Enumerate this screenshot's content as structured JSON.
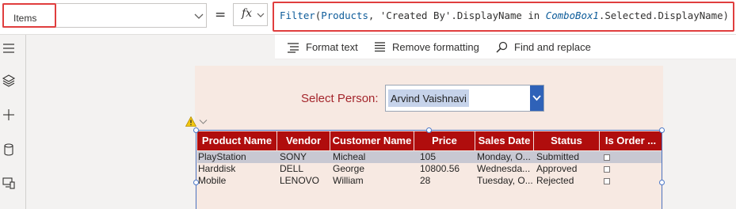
{
  "formula_bar": {
    "property": "Items",
    "equals": "=",
    "fx": "fx",
    "formula_tokens": [
      {
        "t": "Filter",
        "k": "fn"
      },
      {
        "t": "(",
        "k": ""
      },
      {
        "t": "Products",
        "k": "fn"
      },
      {
        "t": ", ",
        "k": ""
      },
      {
        "t": "'Created By'",
        "k": ""
      },
      {
        "t": ".DisplayName in ",
        "k": ""
      },
      {
        "t": "ComboBox1",
        "k": "ctrl"
      },
      {
        "t": ".Selected.DisplayName)",
        "k": ""
      }
    ]
  },
  "toolbar": {
    "format_text": "Format text",
    "remove_formatting": "Remove formatting",
    "find_replace": "Find and replace"
  },
  "screen": {
    "select_label": "Select Person:",
    "combo_selected": "Arvind Vaishnavi"
  },
  "table": {
    "columns": [
      "Product Name",
      "Vendor",
      "Customer Name",
      "Price",
      "Sales Date",
      "Status",
      "Is Order ..."
    ],
    "rows": [
      {
        "product": "PlayStation",
        "vendor": "SONY",
        "customer": "Micheal",
        "price": "105",
        "sales_date": "Monday, O...",
        "status": "Submitted"
      },
      {
        "product": "Harddisk",
        "vendor": "DELL",
        "customer": "George",
        "price": "10800.56",
        "sales_date": "Wednesda...",
        "status": "Approved"
      },
      {
        "product": "Mobile",
        "vendor": "LENOVO",
        "customer": "William",
        "price": "28",
        "sales_date": "Tuesday, O...",
        "status": "Rejected"
      }
    ]
  },
  "colors": {
    "header_bg": "#b00d0d",
    "highlight": "#e03e3e",
    "screen_bg": "#f7e9e2",
    "label": "#a4262c",
    "accent": "#2f62b8"
  }
}
